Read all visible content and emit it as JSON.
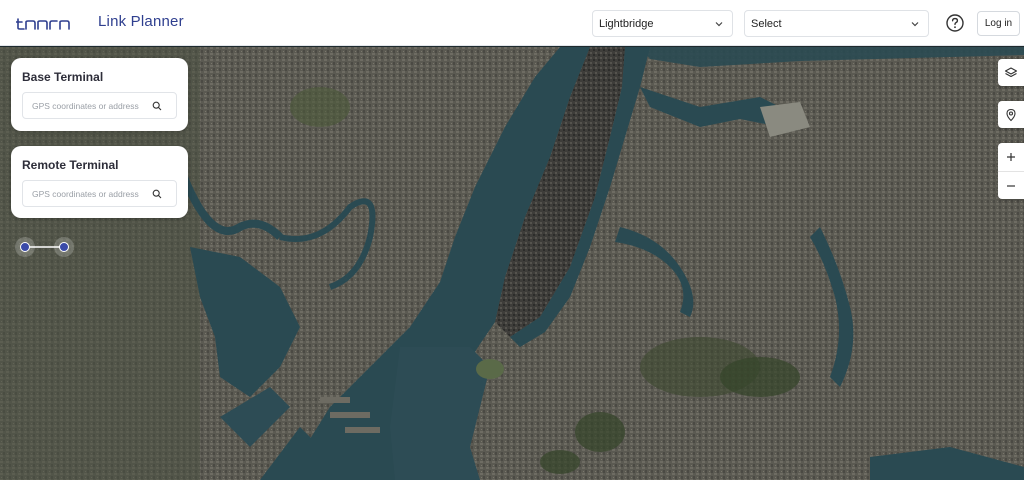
{
  "header": {
    "logo_text": "taara",
    "app_title": "Link Planner",
    "product_select": {
      "value": "Lightbridge"
    },
    "region_select": {
      "value": "Select"
    },
    "help_icon": "question-circle-icon",
    "login_label": "Log in"
  },
  "base_terminal": {
    "title": "Base Terminal",
    "placeholder": "GPS coordinates or address",
    "value": ""
  },
  "remote_terminal": {
    "title": "Remote Terminal",
    "placeholder": "GPS coordinates or address",
    "value": ""
  },
  "map_controls": {
    "layers": "layers-icon",
    "location": "map-pin-icon",
    "zoom_in": "plus-icon",
    "zoom_out": "minus-icon"
  },
  "colors": {
    "brand": "#2f3f8f",
    "water": "#2a4a52",
    "land": "#5d5a4f"
  }
}
